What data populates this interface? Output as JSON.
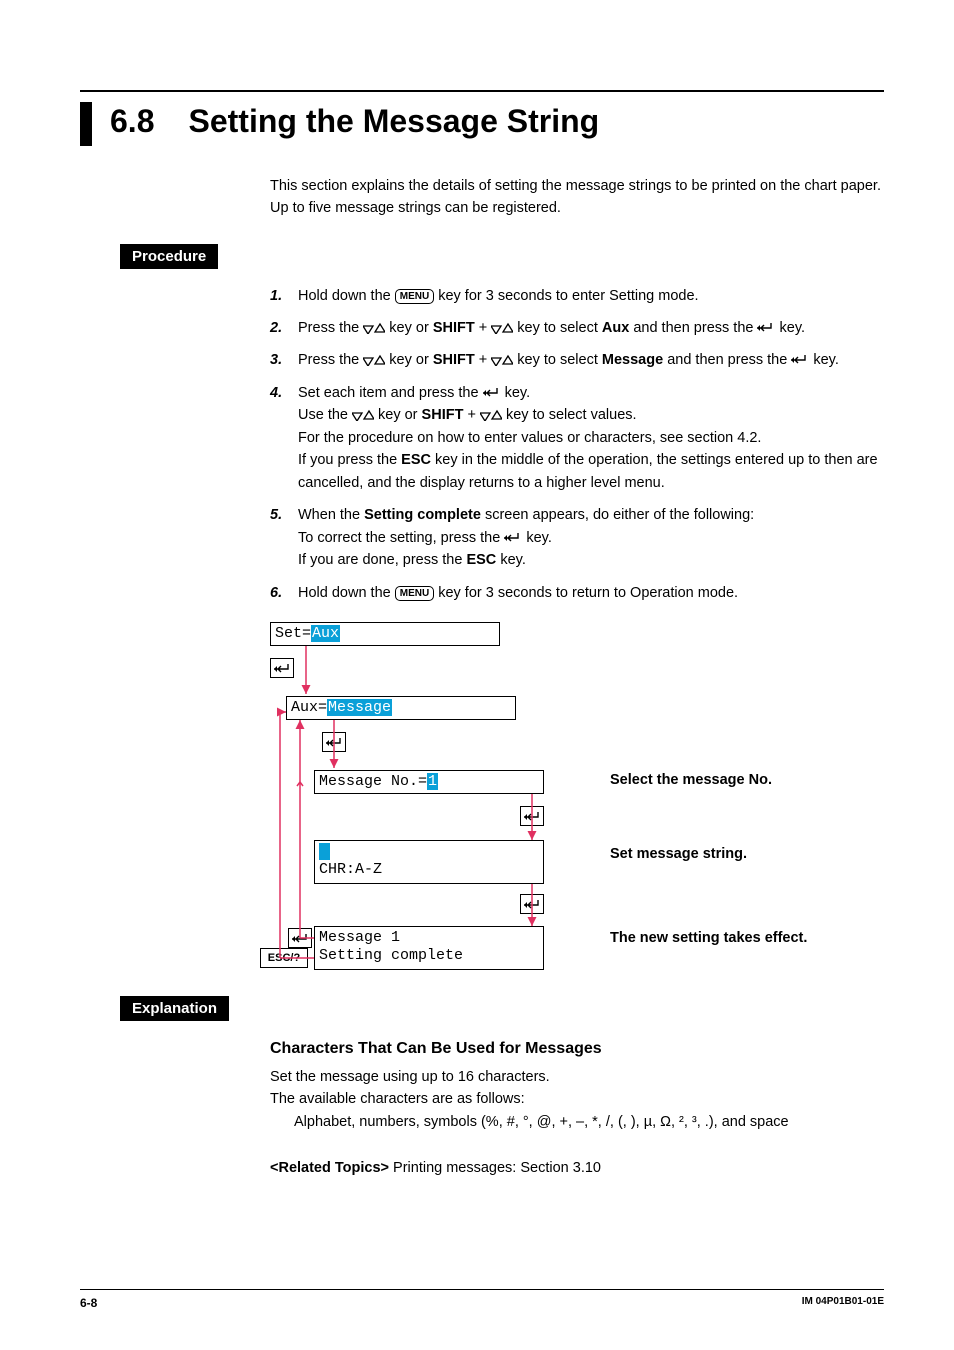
{
  "section": {
    "number": "6.8",
    "title": "Setting the Message String"
  },
  "intro": "This section explains the details of setting the message strings to be printed on the chart paper. Up to five message strings can be registered.",
  "labels": {
    "procedure": "Procedure",
    "explanation": "Explanation",
    "menu_key": "MENU",
    "esc_key": "ESC/?"
  },
  "steps": {
    "s1": {
      "num": "1.",
      "a": "Hold down the ",
      "b": " key for 3 seconds to enter Setting mode."
    },
    "s2": {
      "num": "2.",
      "a": "Press the ",
      "b": " key or ",
      "c": "SHIFT",
      "d": " + ",
      "e": " key to select ",
      "f": "Aux",
      "g": " and then press the ",
      "h": " key."
    },
    "s3": {
      "num": "3.",
      "a": "Press the ",
      "b": " key or ",
      "c": "SHIFT",
      "d": " + ",
      "e": " key to select ",
      "f": "Message",
      "g": " and then press the ",
      "h": " key."
    },
    "s4": {
      "num": "4.",
      "a": "Set each item and press the ",
      "b": " key.",
      "l2a": "Use the ",
      "l2b": " key or ",
      "l2c": "SHIFT",
      "l2d": " + ",
      "l2e": " key to select values.",
      "l3": "For the procedure on how to enter values or characters, see section 4.2.",
      "l4a": "If you press the ",
      "l4b": "ESC",
      "l4c": " key in the middle of the operation, the settings entered up to then are cancelled, and the display returns to a higher level menu."
    },
    "s5": {
      "num": "5.",
      "l1a": "When the ",
      "l1b": "Setting complete",
      "l1c": " screen appears, do either of the following:",
      "l2a": "To correct the setting, press the ",
      "l2b": " key.",
      "l3a": "If you are done, press the ",
      "l3b": "ESC",
      "l3c": " key."
    },
    "s6": {
      "num": "6.",
      "a": "Hold down the ",
      "b": " key for 3 seconds to return to Operation mode."
    }
  },
  "diagram": {
    "lcd1": {
      "pre": "Set=",
      "hl": "Aux"
    },
    "lcd2": {
      "pre": "Aux=",
      "hl": "Message"
    },
    "lcd3": {
      "pre": "Message No.=",
      "hl": "1"
    },
    "lcd4": {
      "l1pre": "",
      "l1hl": " ",
      "l2": "CHR:A-Z"
    },
    "lcd5": {
      "l1": "Message 1",
      "l2": "Setting complete"
    },
    "cap1": "Select the message No.",
    "cap2": "Set message string.",
    "cap3": "The new setting takes effect."
  },
  "explanation": {
    "heading": "Characters That Can Be Used for Messages",
    "l1": "Set the message using up to 16 characters.",
    "l2": "The available characters are as follows:",
    "l3": "Alphabet, numbers, symbols (%, #, °, @, +, –, *, /, (, ), µ, Ω, ², ³, .), and space"
  },
  "related": {
    "label": "<Related Topics>",
    "text": "  Printing messages: Section 3.10"
  },
  "footer": {
    "page": "6-8",
    "doc": "IM 04P01B01-01E"
  }
}
